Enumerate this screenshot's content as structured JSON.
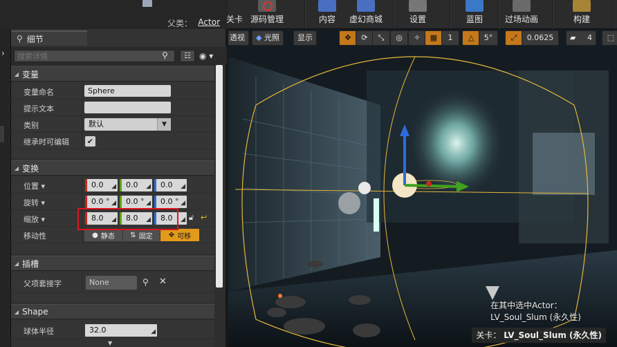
{
  "toolbar": {
    "buttons": [
      {
        "label": "关卡",
        "color": "#6a6a6a"
      },
      {
        "label": "源码管理",
        "color": "#c0392b"
      },
      {
        "label": "内容",
        "color": "#4a6fc2"
      },
      {
        "label": "虚幻商城",
        "color": "#4a6fc2"
      },
      {
        "label": "设置",
        "color": "#8a8a8a"
      },
      {
        "label": "蓝图",
        "color": "#3a78c8"
      },
      {
        "label": "过场动画",
        "color": "#7a7a7a"
      },
      {
        "label": "构建",
        "color": "#b08a3a"
      }
    ]
  },
  "parent": {
    "label": "父类：",
    "value": "Actor"
  },
  "details": {
    "tab_label": "细节",
    "search_placeholder": "搜索详情",
    "sections": {
      "variable": "变量",
      "transform": "变换",
      "sockets": "插槽",
      "shape": "Shape"
    },
    "variable": {
      "name_label": "变量命名",
      "name_value": "Sphere",
      "tooltip_label": "提示文本",
      "tooltip_value": "",
      "category_label": "类别",
      "category_value": "默认",
      "editable_label": "继承时可编辑",
      "editable_checked": true
    },
    "transform": {
      "location_label": "位置",
      "location": [
        "0.0",
        "0.0",
        "0.0"
      ],
      "rotation_label": "旋转",
      "rotation": [
        "0.0 °",
        "0.0 °",
        "0.0 °"
      ],
      "scale_label": "缩放",
      "scale": [
        "8.0",
        "8.0",
        "8.0"
      ],
      "mobility_label": "移动性",
      "mobility_options": [
        "静态",
        "固定",
        "可移"
      ],
      "mobility_selected": "可移"
    },
    "sockets": {
      "parent_socket_label": "父项套接字",
      "parent_socket_value": "None"
    },
    "shape": {
      "radius_label": "球体半径",
      "radius_value": "32.0"
    }
  },
  "viewport": {
    "toolbar": {
      "perspective": "透视",
      "lit": "光照",
      "show": "显示",
      "grid_value": "1",
      "angle_value": "5°",
      "scale_value": "0.0625",
      "camera_speed": "4"
    },
    "info_line1": "在其中选中Actor：",
    "info_line2": "LV_Soul_Slum (永久性)",
    "level_label": "关卡：",
    "level_value": "LV_Soul_Slum (永久性)"
  }
}
